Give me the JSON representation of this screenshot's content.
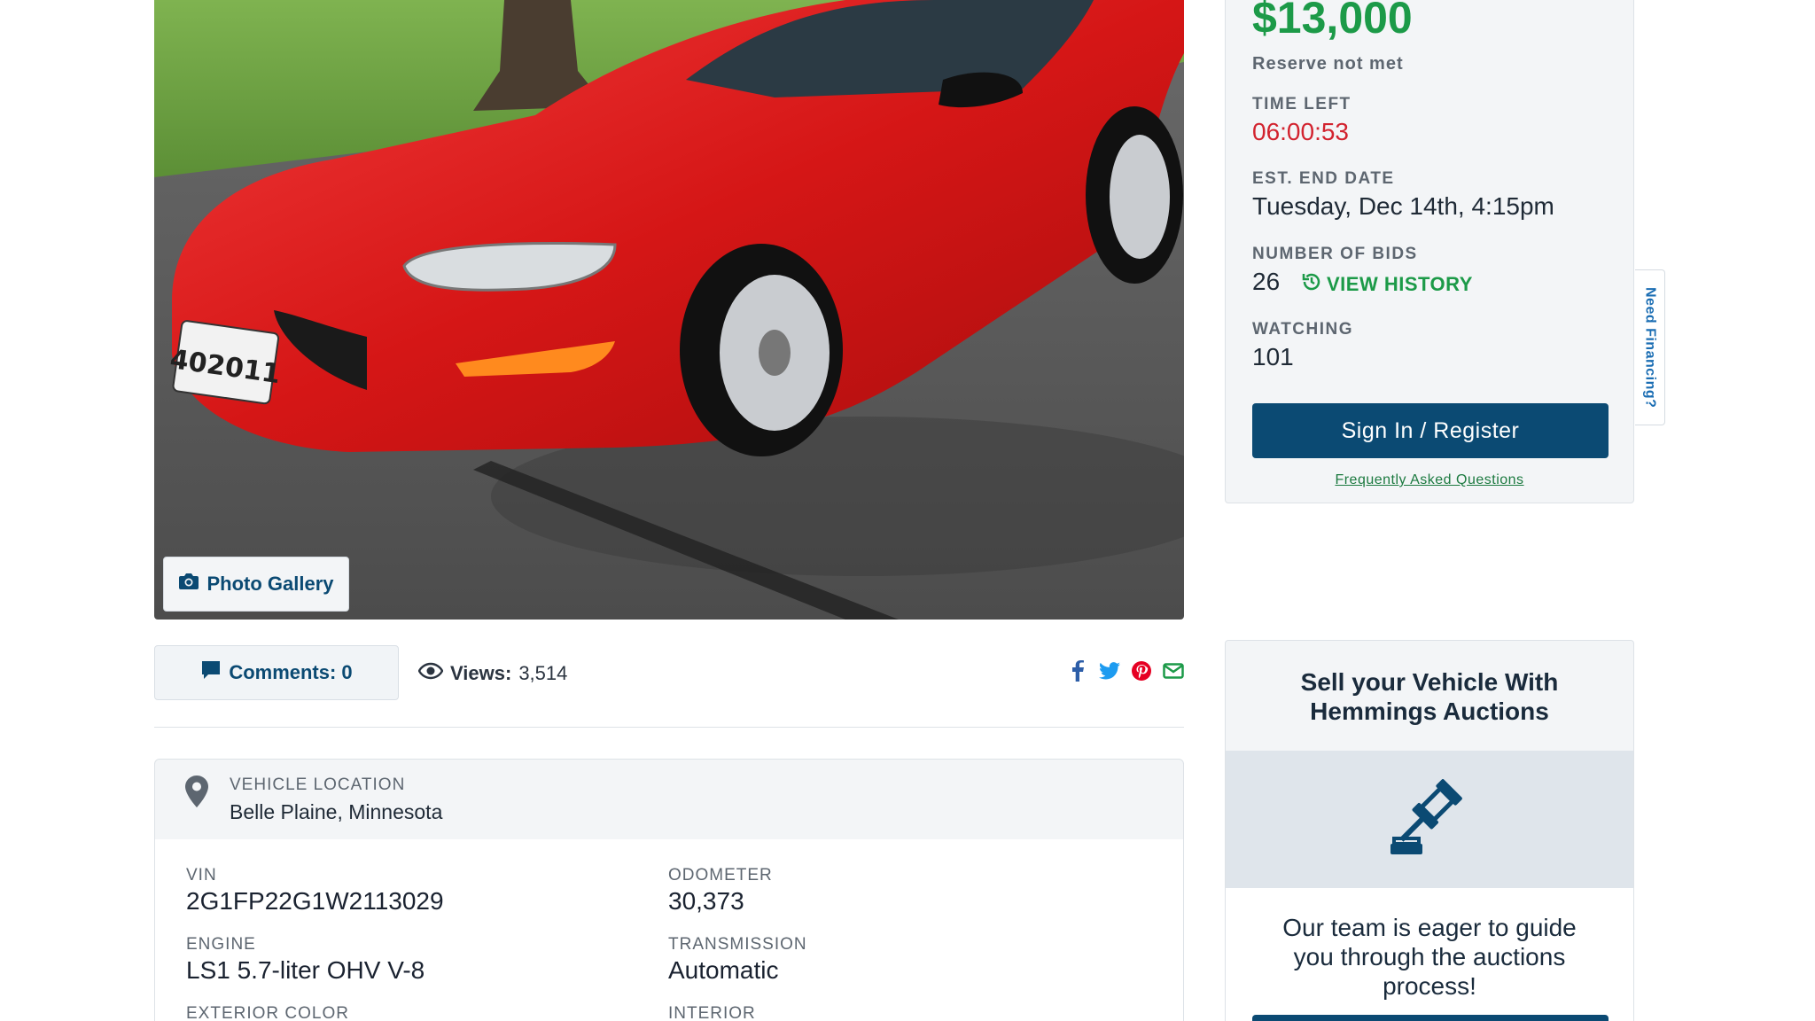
{
  "gallery": {
    "button_label": "Photo Gallery"
  },
  "stats": {
    "comments_label": "Comments: 0",
    "views_label": "Views:",
    "views_value": "3,514"
  },
  "share": {
    "icons": [
      "facebook-icon",
      "twitter-icon",
      "pinterest-icon",
      "email-icon"
    ]
  },
  "location": {
    "label": "VEHICLE LOCATION",
    "value": "Belle Plaine, Minnesota"
  },
  "specs": {
    "vin_label": "VIN",
    "vin_value": "2G1FP22G1W2113029",
    "odometer_label": "ODOMETER",
    "odometer_value": "30,373",
    "engine_label": "ENGINE",
    "engine_value": "LS1 5.7-liter OHV V-8",
    "transmission_label": "TRANSMISSION",
    "transmission_value": "Automatic",
    "exterior_label": "EXTERIOR COLOR",
    "interior_label": "INTERIOR"
  },
  "bid": {
    "price": "$13,000",
    "reserve": "Reserve not met",
    "time_left_label": "TIME LEFT",
    "time_left_value": "06:00:53",
    "end_date_label": "EST. END DATE",
    "end_date_value": "Tuesday, Dec 14th, 4:15pm",
    "bids_label": "NUMBER OF BIDS",
    "bids_value": "26",
    "history_label": "VIEW HISTORY",
    "watching_label": "WATCHING",
    "watching_value": "101",
    "signin_label": "Sign In / Register",
    "faq_label": "Frequently Asked Questions"
  },
  "financing": {
    "label": "Need Financing?"
  },
  "sell": {
    "title": "Sell your Vehicle With Hemmings Auctions",
    "body": "Our team is eager to guide you through the auctions process!"
  },
  "photo": {
    "plate_text": "402011"
  },
  "colors": {
    "brand_blue": "#0b4a73",
    "green": "#1c9a48",
    "red_timer": "#d2232f",
    "car_red": "#e01c1c"
  }
}
